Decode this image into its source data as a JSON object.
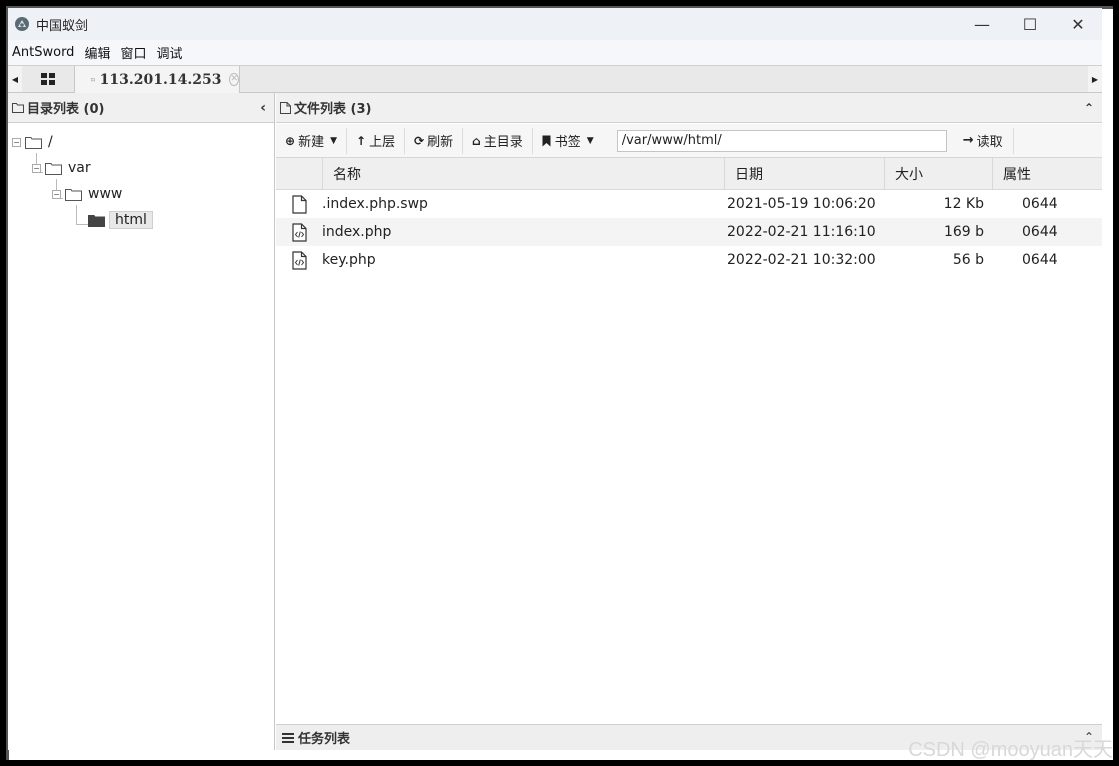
{
  "window": {
    "title": "中国蚁剑",
    "minimize": "—",
    "maximize": "☐",
    "close": "✕"
  },
  "menubar": [
    "AntSword",
    "编辑",
    "窗口",
    "调试"
  ],
  "tabs": {
    "active_label": "113.201.14.253",
    "left_arrow": "◀",
    "right_arrow": "▶"
  },
  "left_panel": {
    "title": "目录列表 (0)",
    "collapse": "‹",
    "tree": [
      {
        "label": "/",
        "level": 0
      },
      {
        "label": "var",
        "level": 1
      },
      {
        "label": "www",
        "level": 2
      },
      {
        "label": "html",
        "level": 3,
        "selected": true
      }
    ]
  },
  "right_panel": {
    "title": "文件列表 (3)",
    "collapse": "⌃",
    "toolbar": {
      "new_label": "新建",
      "up_label": "上层",
      "refresh_label": "刷新",
      "home_label": "主目录",
      "bookmark_label": "书签",
      "path": "/var/www/html/",
      "read_label": "读取"
    },
    "columns": {
      "name": "名称",
      "date": "日期",
      "size": "大小",
      "attr": "属性"
    },
    "files": [
      {
        "name": ".index.php.swp",
        "date": "2021-05-19 10:06:20",
        "size": "12 Kb",
        "attr": "0644",
        "icon": "file-icon"
      },
      {
        "name": "index.php",
        "date": "2022-02-21 11:16:10",
        "size": "169 b",
        "attr": "0644",
        "icon": "code-file-icon"
      },
      {
        "name": "key.php",
        "date": "2022-02-21 10:32:00",
        "size": "56 b",
        "attr": "0644",
        "icon": "code-file-icon"
      }
    ]
  },
  "task_panel": {
    "title": "任务列表",
    "collapse": "⌃"
  },
  "watermark": "CSDN @mooyuan天天"
}
